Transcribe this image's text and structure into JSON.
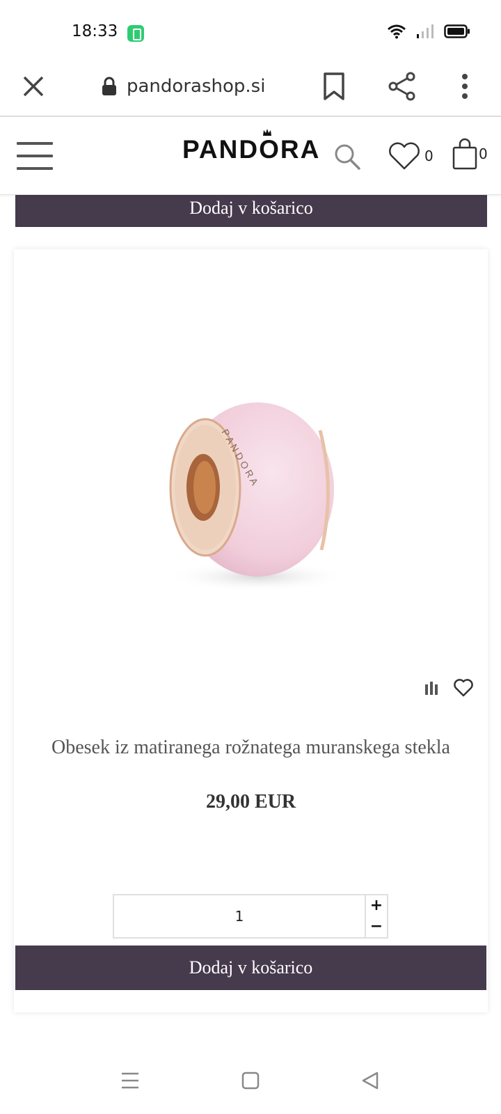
{
  "status_bar": {
    "time": "18:33",
    "icons": [
      "battery-saver-icon",
      "wifi-icon",
      "signal-icon",
      "battery-icon"
    ]
  },
  "browser": {
    "url": "pandorashop.si",
    "icons": [
      "close-icon",
      "lock-icon",
      "bookmark-icon",
      "share-icon",
      "more-vert-icon"
    ]
  },
  "header": {
    "brand": "PANDORA",
    "wishlist_count": "0",
    "cart_count": "0",
    "icons": [
      "menu-icon",
      "search-icon",
      "heart-icon",
      "shopping-bag-icon"
    ]
  },
  "top_cart_button": {
    "label": "Dodaj v košarico"
  },
  "product": {
    "title": "Obesek iz matiranega rožnatega muranskega stekla",
    "price": "29,00 EUR",
    "quantity": "1",
    "qty_plus": "+",
    "qty_minus": "−",
    "add_to_cart": "Dodaj v košarico",
    "image_colors": {
      "glass": "#f1cdda",
      "metal": "#d9a98c"
    }
  },
  "colors": {
    "accent": "#463a4d",
    "battery_saver": "#2ecc71"
  },
  "nav_bar": {
    "icons": [
      "recent-apps-icon",
      "home-icon",
      "back-icon"
    ]
  }
}
